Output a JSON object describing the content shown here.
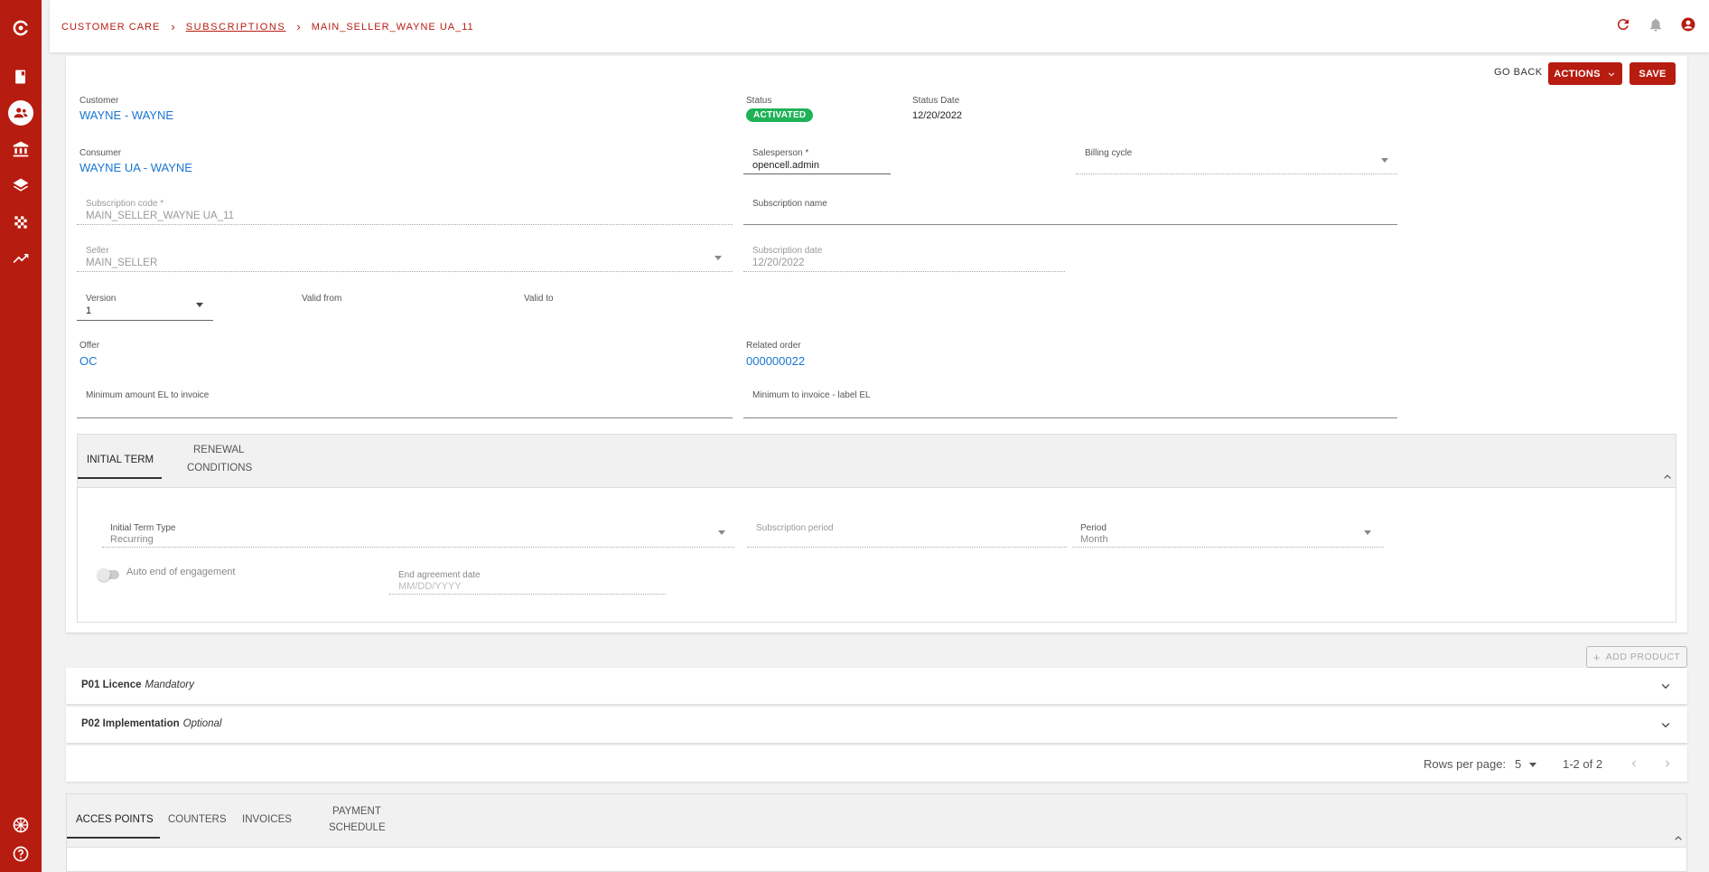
{
  "breadcrumb": {
    "root": "CUSTOMER CARE",
    "section": "SUBSCRIPTIONS",
    "current": "MAIN_SELLER_WAYNE UA_11"
  },
  "colors": {
    "brand": "#b71c10",
    "link": "#1976d2",
    "status_green": "#1fb257"
  },
  "sidebar": {
    "icons": [
      "logo-icon",
      "book-icon",
      "customers-icon",
      "bank-icon",
      "layers-icon",
      "grid-icon",
      "trending-icon",
      "language-flag-icon",
      "help-icon"
    ]
  },
  "header_actions": {
    "go_back": "GO BACK",
    "actions": "ACTIONS",
    "save": "SAVE"
  },
  "form": {
    "customer_label": "Customer",
    "customer_value": "WAYNE - WAYNE",
    "status_label": "Status",
    "status_value": "ACTIVATED",
    "status_date_label": "Status Date",
    "status_date_value": "12/20/2022",
    "consumer_label": "Consumer",
    "consumer_value": "WAYNE UA - WAYNE",
    "salesperson_label": "Salesperson *",
    "salesperson_value": "opencell.admin",
    "billing_cycle_label": "Billing cycle",
    "sub_code_label": "Subscription code *",
    "sub_code_value": "MAIN_SELLER_WAYNE UA_11",
    "sub_name_label": "Subscription name",
    "seller_label": "Seller",
    "seller_value": "MAIN_SELLER",
    "sub_date_label": "Subscription date",
    "sub_date_value": "12/20/2022",
    "version_label": "Version",
    "version_value": "1",
    "valid_from_label": "Valid from",
    "valid_to_label": "Valid to",
    "offer_label": "Offer",
    "offer_value": "OC",
    "related_order_label": "Related order",
    "related_order_value": "000000022",
    "min_amount_label": "Minimum amount EL to invoice",
    "min_label_label": "Minimum to invoice - label EL"
  },
  "term_tabs": {
    "tabs": [
      "INITIAL TERM",
      "RENEWAL",
      "CONDITIONS"
    ],
    "initial_term_type_label": "Initial Term Type",
    "initial_term_type_value": "Recurring",
    "subscription_period_label": "Subscription period",
    "period_label": "Period",
    "period_value": "Month",
    "auto_end_label": "Auto end of engagement",
    "end_agreement_label": "End agreement date",
    "end_agreement_placeholder": "MM/DD/YYYY"
  },
  "products": {
    "add_button": "ADD PRODUCT",
    "items": [
      {
        "code": "P01 Licence",
        "tag": "Mandatory"
      },
      {
        "code": "P02 Implementation",
        "tag": "Optional"
      }
    ]
  },
  "pagination": {
    "rows_label": "Rows per page:",
    "rows_value": "5",
    "range": "1-2 of 2"
  },
  "bottom_tabs": {
    "tabs": [
      "ACCES POINTS",
      "COUNTERS",
      "INVOICES",
      "PAYMENT",
      "SCHEDULE"
    ]
  }
}
